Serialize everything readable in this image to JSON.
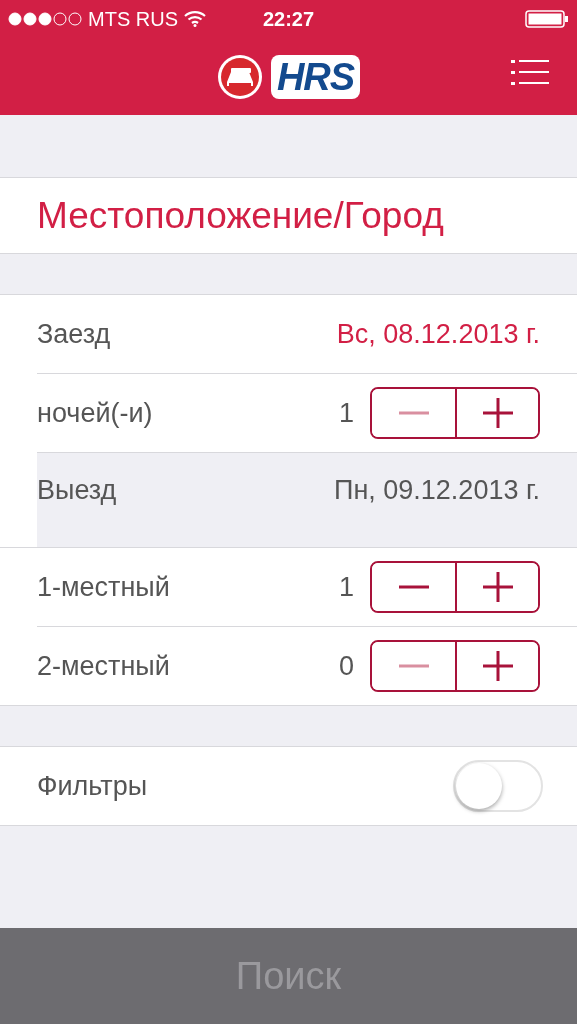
{
  "status_bar": {
    "carrier": "MTS RUS",
    "time": "22:27"
  },
  "nav": {
    "logo": "HRS"
  },
  "location": {
    "placeholder": "Местоположение/Город"
  },
  "checkin": {
    "label": "Заезд",
    "value": "Вс, 08.12.2013 г."
  },
  "nights": {
    "label": "ночей(-и)",
    "count": "1",
    "minus_disabled": true
  },
  "checkout": {
    "label": "Выезд",
    "value": "Пн, 09.12.2013 г."
  },
  "rooms": [
    {
      "label": "1-местный",
      "count": "1",
      "minus_disabled": false
    },
    {
      "label": "2-местный",
      "count": "0",
      "minus_disabled": true
    }
  ],
  "filters": {
    "label": "Фильтры",
    "on": false
  },
  "search_button": {
    "label": "Поиск",
    "disabled": true
  }
}
